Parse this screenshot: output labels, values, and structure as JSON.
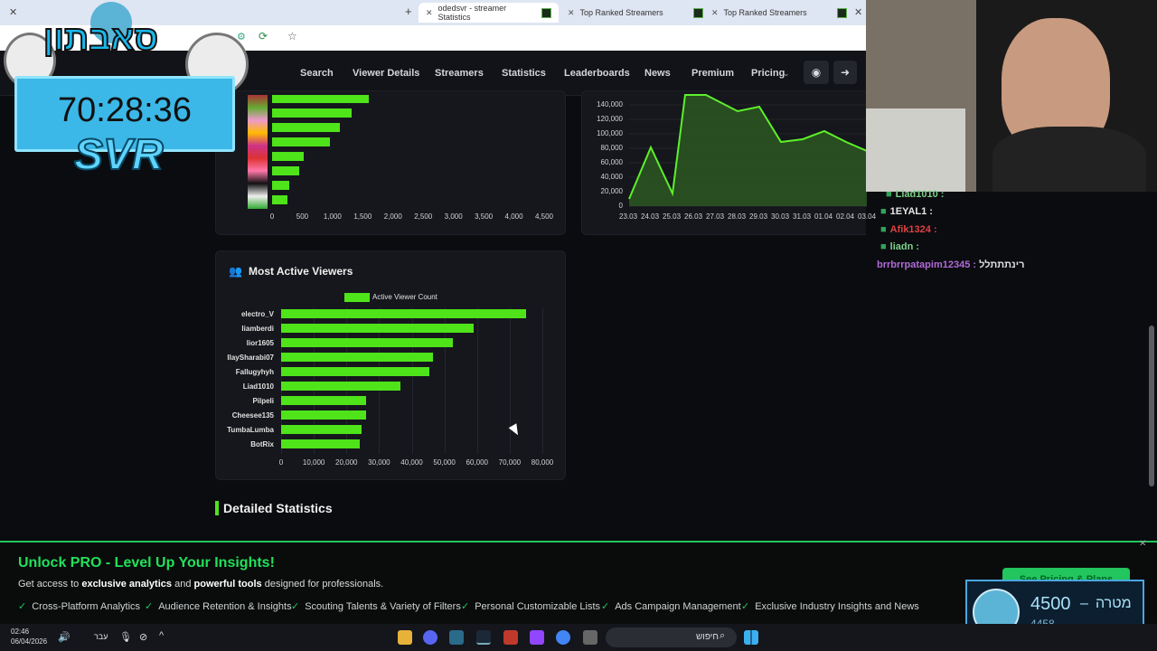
{
  "browser": {
    "tabs": [
      {
        "label": "odedsvr - streamer Statistics",
        "active": true
      },
      {
        "label": "Top Ranked Streamers",
        "active": false
      },
      {
        "label": "Top Ranked Streamers",
        "active": false
      }
    ]
  },
  "nav": {
    "items": [
      "Search",
      "Viewer Details",
      "Streamers",
      "Statistics",
      "Leaderboards",
      "News",
      "Premium",
      "Pricing"
    ]
  },
  "overlay": {
    "logo_text": "סאבתון",
    "timer": "70:28:36",
    "brand": "SVR"
  },
  "top_left_chart": {
    "x_ticks": [
      "0",
      "500",
      "1,000",
      "1,500",
      "2,000",
      "2,500",
      "3,000",
      "3,500",
      "4,000",
      "4,500"
    ]
  },
  "top_right_chart": {
    "y_ticks": [
      "140,000",
      "120,000",
      "100,000",
      "80,000",
      "60,000",
      "40,000",
      "20,000",
      "0"
    ],
    "x_ticks": [
      "23.03",
      "24.03",
      "25.03",
      "26.03",
      "27.03",
      "28.03",
      "29.03",
      "30.03",
      "31.03",
      "01.04",
      "02.04",
      "03.04"
    ]
  },
  "chart_data": {
    "type": "bar",
    "title": "Most Active Viewers",
    "legend": "Active Viewer Count",
    "categories": [
      "electro_V",
      "liamberdi",
      "lior1605",
      "IlaySharabi07",
      "Fallugyhyh",
      "Liad1010",
      "Pilpeli",
      "Cheesee135",
      "TumbaLumba",
      "BotRix"
    ],
    "values": [
      75000,
      59000,
      52500,
      46500,
      45500,
      36500,
      26000,
      26000,
      24500,
      24000
    ],
    "x_ticks": [
      "0",
      "10,000",
      "20,000",
      "30,000",
      "40,000",
      "50,000",
      "60,000",
      "70,000",
      "80,000"
    ],
    "xlim": [
      0,
      80000
    ],
    "color": "#4fe31a"
  },
  "section": {
    "detailed_title": "Detailed Statistics"
  },
  "chat": {
    "lines": [
      {
        "user": "Liad1010 :",
        "color": "#7cd18a"
      },
      {
        "user": "1EYAL1 :",
        "color": "#e0e0e0"
      },
      {
        "user": "Afik1324 :",
        "color": "#e04040"
      },
      {
        "user": "liadn :",
        "color": "#7cd18a"
      },
      {
        "user": "brrbrrpatapim12345 :",
        "color": "#b06ad6",
        "msg": "רינתתתלל"
      }
    ]
  },
  "banner": {
    "title": "Unlock PRO - Level Up Your Insights!",
    "desc_prefix": "Get access to",
    "desc_bold1": "exclusive analytics",
    "desc_mid": "and",
    "desc_bold2": "powerful tools",
    "desc_suffix": "designed for professionals.",
    "cta": "See Pricing & Plans",
    "features": [
      "Cross-Platform Analytics",
      "Audience Retention & Insights",
      "Scouting Talents & Variety of Filters",
      "Personal Customizable Lists",
      "Ads Campaign Management",
      "Exclusive Industry Insights and News"
    ]
  },
  "goal": {
    "current": "4500",
    "label": "מטרה",
    "sub": "4458"
  },
  "taskbar": {
    "time": "02:46",
    "date": "06/04/2026",
    "lang": "עבר",
    "search": "חיפוש"
  }
}
